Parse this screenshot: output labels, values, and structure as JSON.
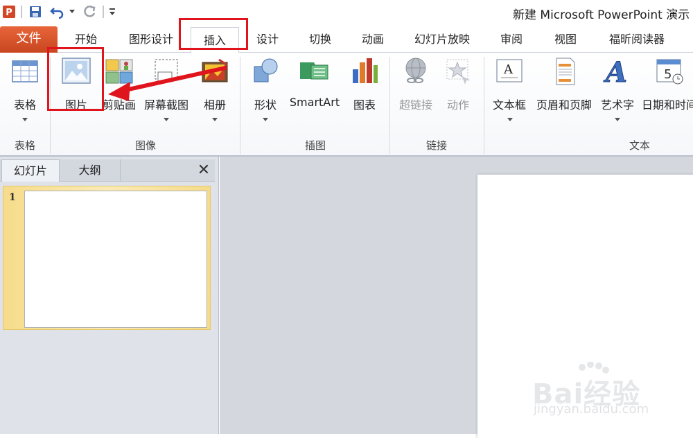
{
  "window": {
    "title": "新建 Microsoft PowerPoint 演示"
  },
  "quick_access": {
    "icons": [
      "powerpoint-logo-icon",
      "save-icon",
      "undo-icon",
      "redo-icon",
      "customize-icon"
    ]
  },
  "tabs": [
    {
      "label": "文件"
    },
    {
      "label": "开始"
    },
    {
      "label": "图形设计"
    },
    {
      "label": "插入"
    },
    {
      "label": "设计"
    },
    {
      "label": "切换"
    },
    {
      "label": "动画"
    },
    {
      "label": "幻灯片放映"
    },
    {
      "label": "审阅"
    },
    {
      "label": "视图"
    },
    {
      "label": "福昕阅读器"
    }
  ],
  "ribbon": {
    "groups": [
      {
        "label": "表格"
      },
      {
        "label": "图像"
      },
      {
        "label": "插图"
      },
      {
        "label": "链接"
      },
      {
        "label": "文本"
      }
    ],
    "buttons": {
      "table": "表格",
      "picture": "图片",
      "clipart": "剪贴画",
      "screenshot": "屏幕截图",
      "album": "相册",
      "shapes": "形状",
      "smartart": "SmartArt",
      "chart": "图表",
      "hyperlink": "超链接",
      "action": "动作",
      "textbox": "文本框",
      "header_footer": "页眉和页脚",
      "wordart": "艺术字",
      "datetime": "日期和时间"
    }
  },
  "left_pane": {
    "tabs": [
      "幻灯片",
      "大纲"
    ],
    "close_label": "✕",
    "slides": [
      {
        "number": "1"
      }
    ]
  },
  "colors": {
    "file_tab": "#d24726",
    "annotation": "#e0141c",
    "selection": "#f6dc8a"
  },
  "watermark": {
    "brand": "Bai经验",
    "url": "jingyan.baidu.com"
  }
}
